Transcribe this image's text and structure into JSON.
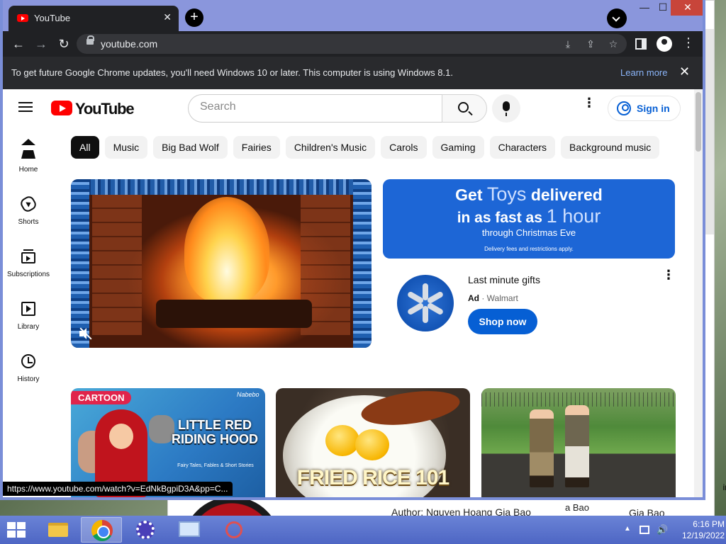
{
  "tab": {
    "title": "YouTube",
    "close": "✕",
    "new_tab": "+"
  },
  "window_controls": {
    "minimize": "—",
    "maximize": "☐",
    "close": "✕"
  },
  "toolbar": {
    "back": "←",
    "forward": "→",
    "reload": "↻",
    "url": "youtube.com",
    "menu": "⋮"
  },
  "infobar": {
    "message": "To get future Google Chrome updates, you'll need Windows 10 or later. This computer is using Windows 8.1.",
    "learn_more": "Learn more",
    "close": "✕"
  },
  "youtube": {
    "logo_text": "YouTube",
    "search_placeholder": "Search",
    "more": "⋮",
    "sign_in": "Sign in",
    "guide": [
      {
        "label": "Home",
        "icon": "home-icon"
      },
      {
        "label": "Shorts",
        "icon": "shorts-icon"
      },
      {
        "label": "Subscriptions",
        "icon": "subscriptions-icon"
      },
      {
        "label": "Library",
        "icon": "library-icon"
      },
      {
        "label": "History",
        "icon": "history-icon"
      }
    ],
    "chips": [
      "All",
      "Music",
      "Big Bad Wolf",
      "Fairies",
      "Children's Music",
      "Carols",
      "Gaming",
      "Characters",
      "Background music"
    ],
    "ad": {
      "banner_line1_a": "Get ",
      "banner_line1_b": "Toys",
      "banner_line1_c": " delivered",
      "banner_line2_a": "in as fast as ",
      "banner_line2_b": "1 hour",
      "banner_line3": "through Christmas Eve",
      "banner_line4": "Delivery fees and restrictions apply.",
      "title": "Last minute gifts",
      "badge": "Ad",
      "separator": " · ",
      "advertiser": "Walmart",
      "cta": "Shop now",
      "more": "⋮"
    },
    "thumbnails": [
      {
        "badge": "CARTOON",
        "title": "LITTLE RED RIDING HOOD",
        "subtitle": "Fairy Tales, Fables & Short Stories",
        "brand": "Nabebo"
      },
      {
        "title": "FRIED RICE 101"
      },
      {}
    ]
  },
  "status_url": "https://www.youtube.com/watch?v=EdNkBgpiD3A&pp=C...",
  "background_window": {
    "author": "Author: Nguyen Hoang Gia Bao",
    "col2": "a Bao",
    "col3": "Gia Bao",
    "side_fragment": "in"
  },
  "taskbar": {
    "apps": [
      {
        "name": "file-explorer",
        "active": false
      },
      {
        "name": "chrome",
        "active": true
      },
      {
        "name": "settings",
        "active": false
      },
      {
        "name": "display",
        "active": false
      },
      {
        "name": "snipping-tool",
        "active": false
      }
    ],
    "tray_chevron": "▲",
    "volume": "🔊",
    "time": "6:16 PM",
    "date": "12/19/2022"
  },
  "colors": {
    "brand_red": "#ff0000",
    "link_blue": "#065fd4",
    "ad_blue": "#1d66d6",
    "chrome_dark": "#202124",
    "taskbar_blue": "#4e66c4"
  }
}
